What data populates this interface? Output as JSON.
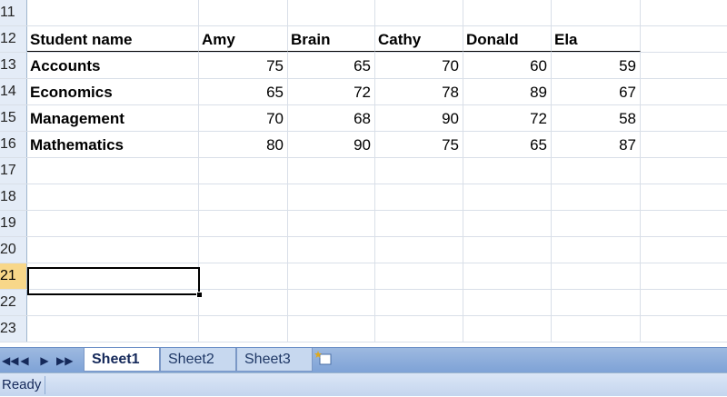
{
  "sheet": {
    "rows": [
      {
        "num": "11",
        "cells": [
          "",
          "",
          "",
          "",
          "",
          ""
        ]
      },
      {
        "num": "12",
        "cells": [
          "Student name",
          "Amy",
          "Brain",
          "Cathy",
          "Donald",
          "Ela"
        ]
      },
      {
        "num": "13",
        "cells": [
          "Accounts",
          "75",
          "65",
          "70",
          "60",
          "59"
        ]
      },
      {
        "num": "14",
        "cells": [
          "Economics",
          "65",
          "72",
          "78",
          "89",
          "67"
        ]
      },
      {
        "num": "15",
        "cells": [
          "Management",
          "70",
          "68",
          "90",
          "72",
          "58"
        ]
      },
      {
        "num": "16",
        "cells": [
          "Mathematics",
          "80",
          "90",
          "75",
          "65",
          "87"
        ]
      },
      {
        "num": "17",
        "cells": [
          "",
          "",
          "",
          "",
          "",
          ""
        ]
      },
      {
        "num": "18",
        "cells": [
          "",
          "",
          "",
          "",
          "",
          ""
        ]
      },
      {
        "num": "19",
        "cells": [
          "",
          "",
          "",
          "",
          "",
          ""
        ]
      },
      {
        "num": "20",
        "cells": [
          "",
          "",
          "",
          "",
          "",
          ""
        ]
      },
      {
        "num": "21",
        "cells": [
          "",
          "",
          "",
          "",
          "",
          ""
        ]
      },
      {
        "num": "22",
        "cells": [
          "",
          "",
          "",
          "",
          "",
          ""
        ]
      },
      {
        "num": "23",
        "cells": [
          "",
          "",
          "",
          "",
          "",
          ""
        ]
      }
    ],
    "selected_row": "21"
  },
  "tabs": {
    "nav": [
      "◀◀",
      "◀",
      "▶",
      "▶▶"
    ],
    "sheets": [
      "Sheet1",
      "Sheet2",
      "Sheet3"
    ],
    "active": "Sheet1",
    "new_sheet_icon": "insert-worksheet-icon"
  },
  "status": {
    "text": "Ready"
  },
  "colors": {
    "header_bg": "#e4ecf7",
    "selected_header_bg": "#f8d789",
    "tabbar_bg": "#8fb0de"
  }
}
